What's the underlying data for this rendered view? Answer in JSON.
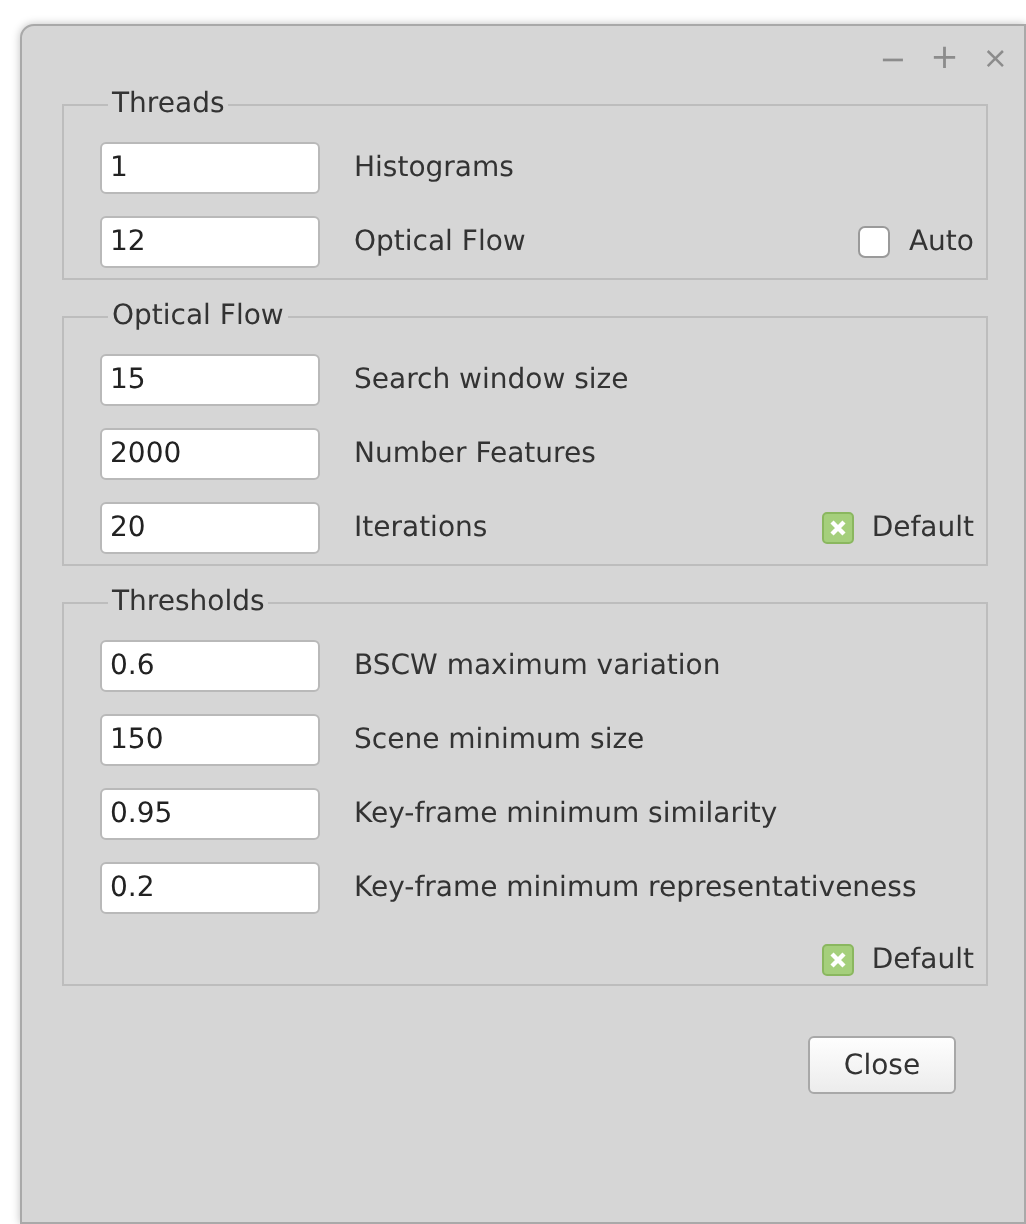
{
  "window": {
    "controls": [
      {
        "kind": "minimize",
        "label": "−"
      },
      {
        "kind": "maximize",
        "label": "+"
      },
      {
        "kind": "close",
        "label": "×"
      }
    ]
  },
  "groups": [
    {
      "title": "Threads",
      "rows": [
        {
          "value": "1",
          "label": "Histograms"
        },
        {
          "value": "12",
          "label": "Optical Flow",
          "check": {
            "label": "Auto",
            "checked": false
          }
        }
      ]
    },
    {
      "title": "Optical Flow",
      "rows": [
        {
          "value": "15",
          "label": "Search window size"
        },
        {
          "value": "2000",
          "label": "Number Features"
        },
        {
          "value": "20",
          "label": "Iterations",
          "check": {
            "label": "Default",
            "checked": true
          }
        }
      ]
    },
    {
      "title": "Thresholds",
      "rows": [
        {
          "value": "0.6",
          "label": "BSCW maximum variation"
        },
        {
          "value": "150",
          "label": "Scene minimum size"
        },
        {
          "value": "0.95",
          "label": "Key-frame minimum similarity"
        },
        {
          "value": "0.2",
          "label": "Key-frame minimum representativeness"
        }
      ],
      "check": {
        "label": "Default",
        "checked": true
      }
    }
  ],
  "buttons": [
    {
      "label": "Close"
    }
  ]
}
